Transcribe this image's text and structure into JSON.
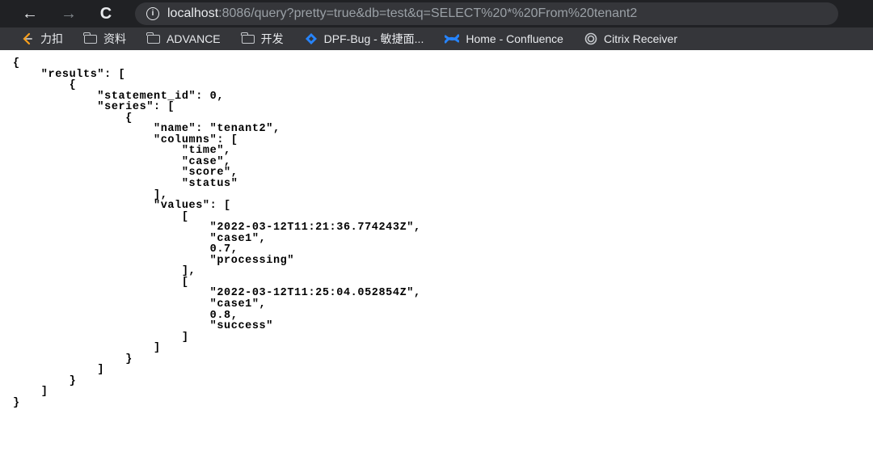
{
  "toolbar": {
    "back_icon": "←",
    "forward_icon": "→",
    "reload_icon": "C",
    "url_host": "localhost",
    "url_rest": ":8086/query?pretty=true&db=test&q=SELECT%20*%20From%20tenant2"
  },
  "bookmarks": [
    {
      "label": "力扣",
      "icon": "leetcode-icon"
    },
    {
      "label": "资料",
      "icon": "folder-icon"
    },
    {
      "label": "ADVANCE",
      "icon": "folder-icon"
    },
    {
      "label": "开发",
      "icon": "folder-icon"
    },
    {
      "label": "DPF-Bug - 敏捷面...",
      "icon": "jira-icon"
    },
    {
      "label": "Home - Confluence",
      "icon": "confluence-icon"
    },
    {
      "label": "Citrix Receiver",
      "icon": "citrix-icon"
    }
  ],
  "json_text": "{\n    \"results\": [\n        {\n            \"statement_id\": 0,\n            \"series\": [\n                {\n                    \"name\": \"tenant2\",\n                    \"columns\": [\n                        \"time\",\n                        \"case\",\n                        \"score\",\n                        \"status\"\n                    ],\n                    \"values\": [\n                        [\n                            \"2022-03-12T11:21:36.774243Z\",\n                            \"case1\",\n                            0.7,\n                            \"processing\"\n                        ],\n                        [\n                            \"2022-03-12T11:25:04.052854Z\",\n                            \"case1\",\n                            0.8,\n                            \"success\"\n                        ]\n                    ]\n                }\n            ]\n        }\n    ]\n}"
}
